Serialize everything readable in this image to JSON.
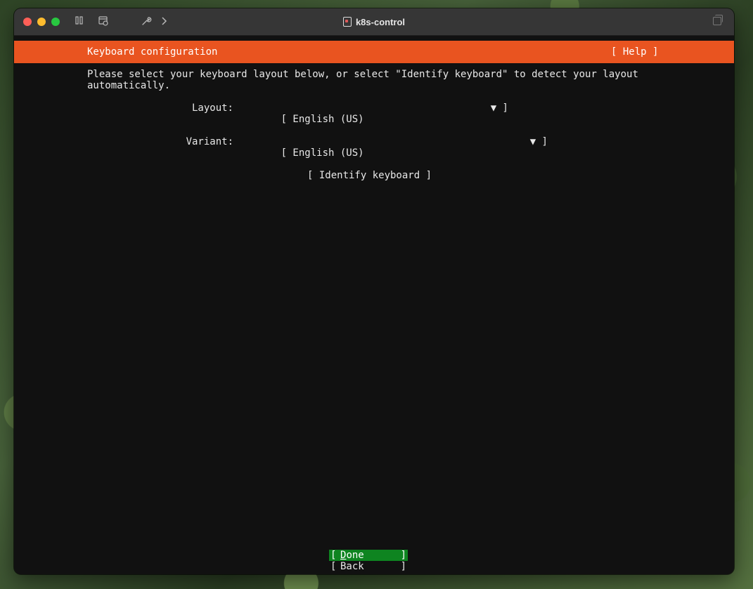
{
  "window": {
    "title": "k8s-control"
  },
  "toolbar": {
    "pause_icon": "pause-icon",
    "snapshot_icon": "snapshot-icon",
    "wrench_icon": "wrench-icon",
    "forward_icon": "chevron-right-icon"
  },
  "installer": {
    "header_title": "Keyboard configuration",
    "help_label": "[ Help ]",
    "info_text": "Please select your keyboard layout below, or select \"Identify keyboard\" to detect your layout\nautomatically.",
    "layout": {
      "label": "Layout:",
      "value": "[ English (US)",
      "arrow": "▼ ]"
    },
    "variant": {
      "label": "Variant:",
      "value": "[ English (US)",
      "arrow": "▼ ]"
    },
    "identify_label": "[ Identify keyboard ]",
    "done": {
      "left_bracket": "[",
      "first_letter": "D",
      "rest": "one",
      "right_bracket": "]"
    },
    "back": {
      "left_bracket": "[",
      "label": "Back",
      "right_bracket": "]"
    }
  },
  "colors": {
    "header_orange": "#e95420",
    "done_green": "#0e8420",
    "terminal_bg": "#111111"
  }
}
